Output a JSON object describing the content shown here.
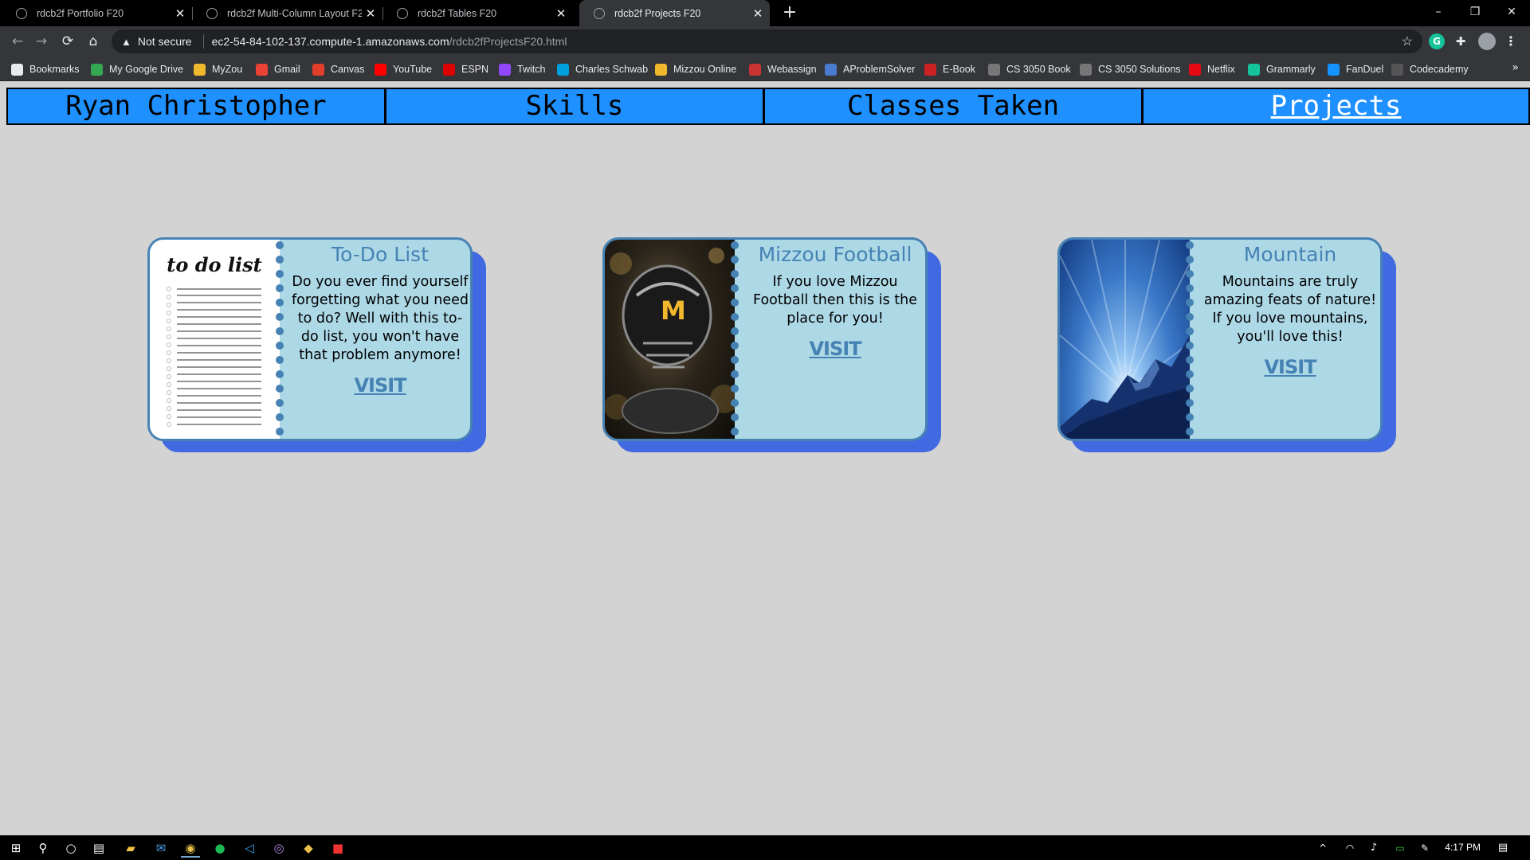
{
  "browser": {
    "tabs": [
      {
        "title": "rdcb2f Portfolio F20",
        "active": false
      },
      {
        "title": "rdcb2f Multi-Column Layout F20",
        "active": false
      },
      {
        "title": "rdcb2f Tables F20",
        "active": false
      },
      {
        "title": "rdcb2f Projects F20",
        "active": true
      }
    ],
    "new_tab": "+",
    "window_controls": {
      "minimize": "–",
      "restore": "❐",
      "close": "✕"
    },
    "nav": {
      "back": "←",
      "forward": "→",
      "reload": "⟳",
      "home": "⌂"
    },
    "address": {
      "security_label": "Not secure",
      "host": "ec2-54-84-102-137.compute-1.amazonaws.com",
      "path": "/rdcb2fProjectsF20.html"
    },
    "bookmarks": [
      {
        "label": "Bookmarks",
        "icon": "star-icon",
        "color": "#e8eaed"
      },
      {
        "label": "My Google Drive",
        "icon": "google-drive-icon",
        "color": "#34a853"
      },
      {
        "label": "MyZou",
        "icon": "myzou-icon",
        "color": "#f1b82d"
      },
      {
        "label": "Gmail",
        "icon": "gmail-icon",
        "color": "#ea4335"
      },
      {
        "label": "Canvas",
        "icon": "canvas-icon",
        "color": "#e13f2b"
      },
      {
        "label": "YouTube",
        "icon": "youtube-icon",
        "color": "#ff0000"
      },
      {
        "label": "ESPN",
        "icon": "espn-icon",
        "color": "#d00"
      },
      {
        "label": "Twitch",
        "icon": "twitch-icon",
        "color": "#9146ff"
      },
      {
        "label": "Charles Schwab",
        "icon": "schwab-icon",
        "color": "#00a0df"
      },
      {
        "label": "Mizzou Online",
        "icon": "mizzou-icon",
        "color": "#f1b82d"
      },
      {
        "label": "Webassign",
        "icon": "webassign-icon",
        "color": "#c33"
      },
      {
        "label": "AProblemSolver",
        "icon": "aproblemsolver-icon",
        "color": "#4a7bd0"
      },
      {
        "label": "E-Book",
        "icon": "ebook-icon",
        "color": "#c22"
      },
      {
        "label": "CS 3050 Book",
        "icon": "globe-icon",
        "color": "#777"
      },
      {
        "label": "CS 3050 Solutions",
        "icon": "w-icon",
        "color": "#777"
      },
      {
        "label": "Netflix",
        "icon": "netflix-icon",
        "color": "#e50914"
      },
      {
        "label": "Grammarly",
        "icon": "grammarly-icon",
        "color": "#15c39a"
      },
      {
        "label": "FanDuel",
        "icon": "fanduel-icon",
        "color": "#1493ff"
      },
      {
        "label": "Codecademy",
        "icon": "codecademy-icon",
        "color": "#555"
      }
    ],
    "bookmarks_more": "»"
  },
  "site_nav": {
    "items": [
      {
        "label": "Ryan Christopher",
        "current": false
      },
      {
        "label": "Skills",
        "current": false
      },
      {
        "label": "Classes Taken",
        "current": false
      },
      {
        "label": "Projects",
        "current": true
      }
    ]
  },
  "cards": [
    {
      "title": "To-Do List",
      "description": "Do you ever find yourself forgetting what you need to do? Well with this to-do list, you won't have that problem anymore!",
      "link": "VISIT",
      "image": "to-do-list-notebook-image",
      "image_caption": "to do list"
    },
    {
      "title": "Mizzou Football",
      "description": "If you love Mizzou Football then this is the place for you!",
      "link": "VISIT",
      "image": "mizzou-football-helmet-image"
    },
    {
      "title": "Mountain",
      "description": "Mountains are truly amazing feats of nature! If you love mountains, you'll love this!",
      "link": "VISIT",
      "image": "blue-mountain-image"
    }
  ],
  "taskbar": {
    "time": "4:17 PM"
  }
}
